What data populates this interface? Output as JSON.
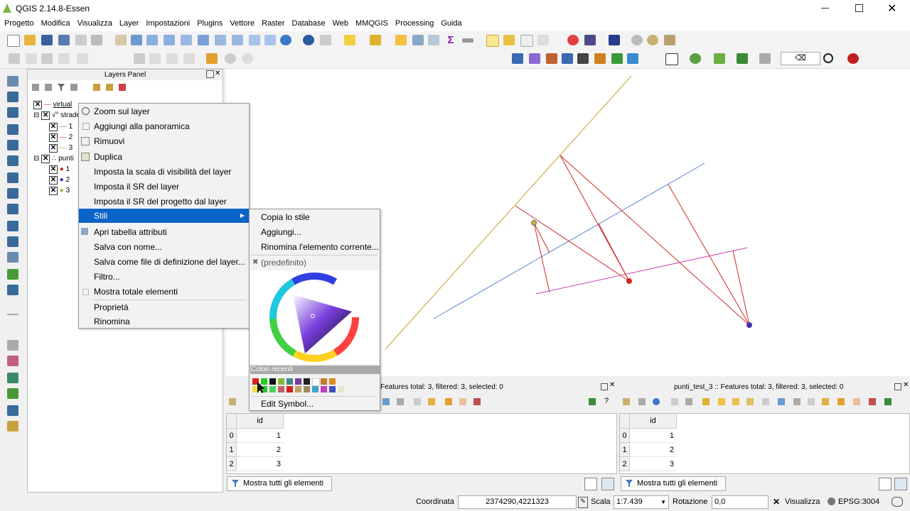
{
  "window": {
    "title": "QGIS 2.14.8-Essen"
  },
  "menu": [
    "Progetto",
    "Modifica",
    "Visualizza",
    "Layer",
    "Impostazioni",
    "Plugins",
    "Vettore",
    "Raster",
    "Database",
    "Web",
    "MMQGIS",
    "Processing",
    "Guida"
  ],
  "layers_panel": {
    "title": "Layers Panel",
    "items": [
      {
        "label": "virtual"
      },
      {
        "label": "strade"
      },
      {
        "label": "1"
      },
      {
        "label": "2"
      },
      {
        "label": "3"
      },
      {
        "label": "punti"
      },
      {
        "label": "1"
      },
      {
        "label": "2"
      },
      {
        "label": "3"
      }
    ]
  },
  "context_menu": {
    "items": [
      {
        "label": "Zoom sul layer"
      },
      {
        "label": "Aggiungi alla panoramica"
      },
      {
        "label": "Rimuovi"
      },
      {
        "label": "Duplica"
      },
      {
        "label": "Imposta la scala di visibilità del layer"
      },
      {
        "label": "Imposta il SR del layer"
      },
      {
        "label": "Imposta il SR del progetto dal layer"
      },
      {
        "label": "Stili"
      },
      {
        "label": "Apri tabella attributi"
      },
      {
        "label": "Salva con nome..."
      },
      {
        "label": "Salva come file di definizione del layer..."
      },
      {
        "label": "Filtro..."
      },
      {
        "label": "Mostra totale elementi"
      },
      {
        "label": "Proprietà"
      },
      {
        "label": "Rinomina"
      }
    ]
  },
  "styles_submenu": {
    "copy": "Copia lo stile",
    "add": "Aggiungi...",
    "rename": "Rinomina l'elemento corrente...",
    "default": "(predefinito)",
    "recent_colors_label": "Colori recenti",
    "edit_symbol": "Edit Symbol...",
    "recent_colors": [
      "#e02020",
      "#22cc22",
      "#111111",
      "#86b83c",
      "#3a8a8a",
      "#7a3aa0",
      "#222222",
      "#ffffff",
      "#c07a30",
      "#e08a20",
      "#f0e040",
      "#30c030",
      "#50d060",
      "#c06060",
      "#d02020",
      "#c0a060",
      "#9a8a60",
      "#40a0d0",
      "#c040c0",
      "#4050c0",
      "#e8e8c8"
    ]
  },
  "attr_tables": [
    {
      "header": "Features total: 3, filtered: 3, selected: 0",
      "column": "id",
      "rows": [
        {
          "idx": "0",
          "id": "1"
        },
        {
          "idx": "1",
          "id": "2"
        },
        {
          "idx": "2",
          "id": "3"
        }
      ],
      "filter_button": "Mostra tutti gli elementi"
    },
    {
      "header": "punti_test_3 :: Features total: 3, filtered: 3, selected: 0",
      "column": "id",
      "rows": [
        {
          "idx": "0",
          "id": "1"
        },
        {
          "idx": "1",
          "id": "2"
        },
        {
          "idx": "2",
          "id": "3"
        }
      ],
      "filter_button": "Mostra tutti gli elementi"
    }
  ],
  "statusbar": {
    "coord_label": "Coordinata",
    "coord_value": "2374290,4221323",
    "scale_label": "Scala",
    "scale_value": "1:7.439",
    "rotation_label": "Rotazione",
    "rotation_value": "0,0",
    "render_label": "Visualizza",
    "crs": "EPSG:3004"
  },
  "colors": {
    "accent": "#0a64c8",
    "line_gold": "#c8a030",
    "line_blue": "#5a8ad0",
    "line_red": "#d02828",
    "line_pink": "#d040b0"
  }
}
